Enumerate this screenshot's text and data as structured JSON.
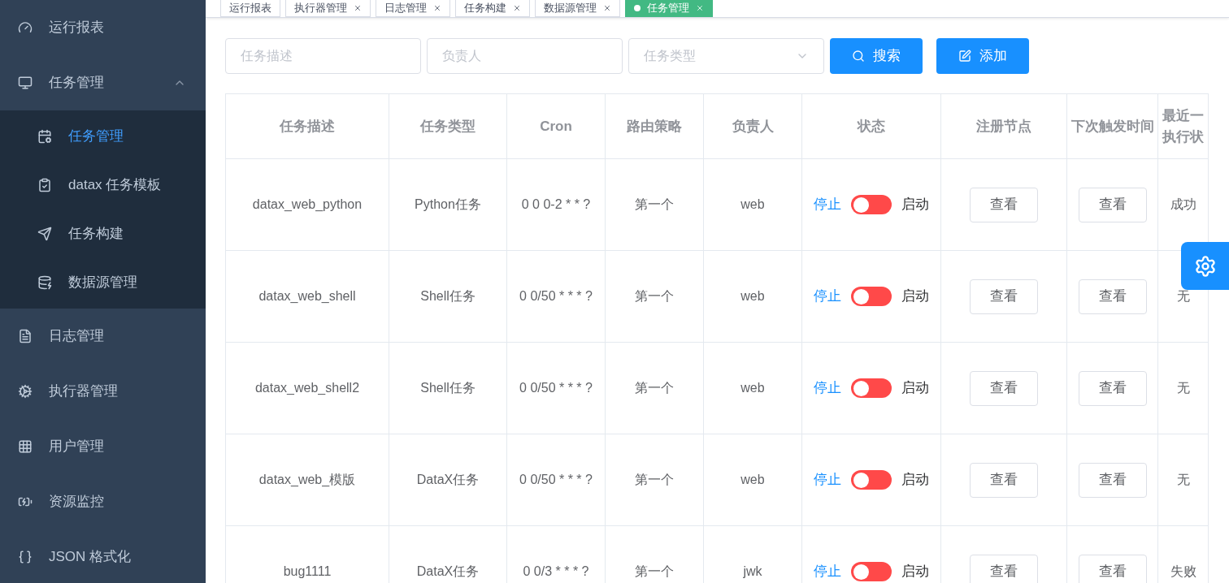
{
  "sidebar": {
    "items": [
      {
        "label": "运行报表",
        "selected": false
      },
      {
        "label": "任务管理",
        "selected": false,
        "expanded": true,
        "children": [
          {
            "label": "任务管理",
            "selected": true
          },
          {
            "label": "datax 任务模板",
            "selected": false
          },
          {
            "label": "任务构建",
            "selected": false
          },
          {
            "label": "数据源管理",
            "selected": false
          }
        ]
      },
      {
        "label": "日志管理",
        "selected": false
      },
      {
        "label": "执行器管理",
        "selected": false
      },
      {
        "label": "用户管理",
        "selected": false
      },
      {
        "label": "资源监控",
        "selected": false
      },
      {
        "label": "JSON 格式化",
        "selected": false
      }
    ]
  },
  "tabs": [
    {
      "label": "运行报表",
      "selected": false,
      "closable": false
    },
    {
      "label": "执行器管理",
      "selected": false,
      "closable": true
    },
    {
      "label": "日志管理",
      "selected": false,
      "closable": true
    },
    {
      "label": "任务构建",
      "selected": false,
      "closable": true
    },
    {
      "label": "数据源管理",
      "selected": false,
      "closable": true
    },
    {
      "label": "任务管理",
      "selected": true,
      "closable": true
    }
  ],
  "filters": [
    {
      "kind": "input",
      "placeholder": "任务描述"
    },
    {
      "kind": "input",
      "placeholder": "负责人"
    },
    {
      "kind": "select",
      "placeholder": "任务类型"
    }
  ],
  "buttons": [
    {
      "kind": "search",
      "label": "搜索"
    },
    {
      "kind": "add",
      "label": "添加"
    }
  ],
  "table": {
    "columns": [
      "任务描述",
      "任务类型",
      "Cron",
      "路由策略",
      "负责人",
      "状态",
      "注册节点",
      "下次触发时间",
      "最近一执行状"
    ],
    "rows": [
      {
        "description": "datax_web_python",
        "type": "Python任务",
        "cron": "0 0 0-2 * * ?",
        "route": "第一个",
        "owner": "web",
        "status": {
          "on": false,
          "off_label": "停止",
          "on_label": "启动"
        },
        "node_button": "查看",
        "next_button": "查看",
        "last_result": "成功"
      },
      {
        "description": "datax_web_shell",
        "type": "Shell任务",
        "cron": "0 0/50 * * * ?",
        "route": "第一个",
        "owner": "web",
        "status": {
          "on": false,
          "off_label": "停止",
          "on_label": "启动"
        },
        "node_button": "查看",
        "next_button": "查看",
        "last_result": "无"
      },
      {
        "description": "datax_web_shell2",
        "type": "Shell任务",
        "cron": "0 0/50 * * * ?",
        "route": "第一个",
        "owner": "web",
        "status": {
          "on": false,
          "off_label": "停止",
          "on_label": "启动"
        },
        "node_button": "查看",
        "next_button": "查看",
        "last_result": "无"
      },
      {
        "description": "datax_web_模版",
        "type": "DataX任务",
        "cron": "0 0/50 * * * ?",
        "route": "第一个",
        "owner": "web",
        "status": {
          "on": false,
          "off_label": "停止",
          "on_label": "启动"
        },
        "node_button": "查看",
        "next_button": "查看",
        "last_result": "无"
      },
      {
        "description": "bug1111",
        "type": "DataX任务",
        "cron": "0 0/3 * * * ?",
        "route": "第一个",
        "owner": "jwk",
        "status": {
          "on": false,
          "off_label": "停止",
          "on_label": "启动"
        },
        "node_button": "查看",
        "next_button": "查看",
        "last_result": "失败"
      }
    ]
  }
}
